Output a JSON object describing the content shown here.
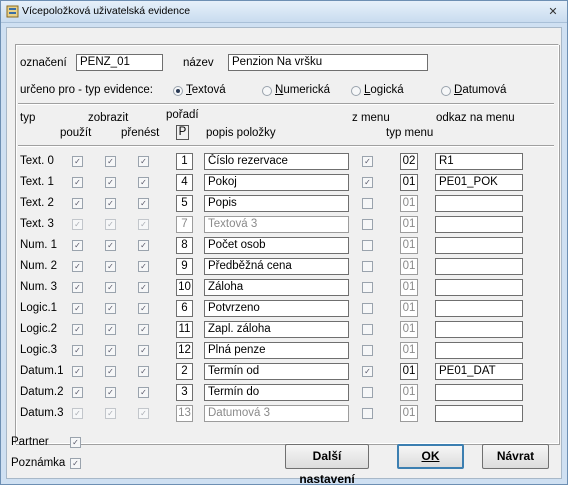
{
  "window": {
    "title": "Vícepoložková uživatelská evidence",
    "close_glyph": "✕"
  },
  "top": {
    "oznaceni_label": "označení",
    "oznaceni_value": "PENZ_01",
    "nazev_label": "název",
    "nazev_value": "Penzion Na vršku",
    "urceno_label": "určeno pro - typ evidence:",
    "radio_options": [
      "Textová",
      "Numerická",
      "Logická",
      "Datumová"
    ],
    "selected_option": "Textová"
  },
  "headers": {
    "typ": "typ",
    "zobrazit": "zobrazit",
    "pouzit": "použít",
    "prenest": "přenést",
    "poradi": "pořadí",
    "poradi_p": "P",
    "popis": "popis položky",
    "zmenu": "z menu",
    "typmenu": "typ menu",
    "odkaz": "odkaz na menu"
  },
  "rows": [
    {
      "typ": "Text. 0",
      "pouzit": true,
      "prenest": true,
      "poradi": "1",
      "popis": "Číslo rezervace",
      "zmenu": true,
      "typmenu": "02",
      "odkaz": "R1",
      "enabled": true
    },
    {
      "typ": "Text. 1",
      "pouzit": true,
      "prenest": true,
      "poradi": "4",
      "popis": "Pokoj",
      "zmenu": true,
      "typmenu": "01",
      "odkaz": "PE01_POK",
      "enabled": true
    },
    {
      "typ": "Text. 2",
      "pouzit": true,
      "prenest": true,
      "poradi": "5",
      "popis": "Popis",
      "zmenu": false,
      "typmenu": "01",
      "odkaz": "",
      "enabled": true
    },
    {
      "typ": "Text. 3",
      "pouzit": false,
      "prenest": false,
      "poradi": "7",
      "popis": "Textová 3",
      "zmenu": false,
      "typmenu": "01",
      "odkaz": "",
      "enabled": false
    },
    {
      "typ": "Num. 1",
      "pouzit": true,
      "prenest": true,
      "poradi": "8",
      "popis": "Počet osob",
      "zmenu": false,
      "typmenu": "01",
      "odkaz": "",
      "enabled": true
    },
    {
      "typ": "Num. 2",
      "pouzit": true,
      "prenest": true,
      "poradi": "9",
      "popis": "Předběžná cena",
      "zmenu": false,
      "typmenu": "01",
      "odkaz": "",
      "enabled": true
    },
    {
      "typ": "Num. 3",
      "pouzit": true,
      "prenest": true,
      "poradi": "10",
      "popis": "Záloha",
      "zmenu": false,
      "typmenu": "01",
      "odkaz": "",
      "enabled": true
    },
    {
      "typ": "Logic.1",
      "pouzit": true,
      "prenest": true,
      "poradi": "6",
      "popis": "Potvrzeno",
      "zmenu": false,
      "typmenu": "01",
      "odkaz": "",
      "enabled": true
    },
    {
      "typ": "Logic.2",
      "pouzit": true,
      "prenest": true,
      "poradi": "11",
      "popis": "Zapl. záloha",
      "zmenu": false,
      "typmenu": "01",
      "odkaz": "",
      "enabled": true
    },
    {
      "typ": "Logic.3",
      "pouzit": true,
      "prenest": true,
      "poradi": "12",
      "popis": "Plná penze",
      "zmenu": false,
      "typmenu": "01",
      "odkaz": "",
      "enabled": true
    },
    {
      "typ": "Datum.1",
      "pouzit": true,
      "prenest": true,
      "poradi": "2",
      "popis": "Termín od",
      "zmenu": true,
      "typmenu": "01",
      "odkaz": "PE01_DAT",
      "enabled": true
    },
    {
      "typ": "Datum.2",
      "pouzit": true,
      "prenest": true,
      "poradi": "3",
      "popis": "Termín do",
      "zmenu": false,
      "typmenu": "01",
      "odkaz": "",
      "enabled": true
    },
    {
      "typ": "Datum.3",
      "pouzit": false,
      "prenest": false,
      "poradi": "13",
      "popis": "Datumová 3",
      "zmenu": false,
      "typmenu": "01",
      "odkaz": "",
      "enabled": false
    }
  ],
  "bottom": {
    "partner_label": "Partner",
    "partner_checked": true,
    "poznamka_label": "Poznámka",
    "poznamka_checked": true,
    "dalsi_label": "Další nastavení",
    "ok_label": "OK",
    "navrat_label": "Návrat"
  },
  "colors": {
    "window_frame": "#cfe0f2",
    "client_bg": "#f0f0f0",
    "default_button_border": "#3c7fb1"
  },
  "check_glyph": "✓"
}
